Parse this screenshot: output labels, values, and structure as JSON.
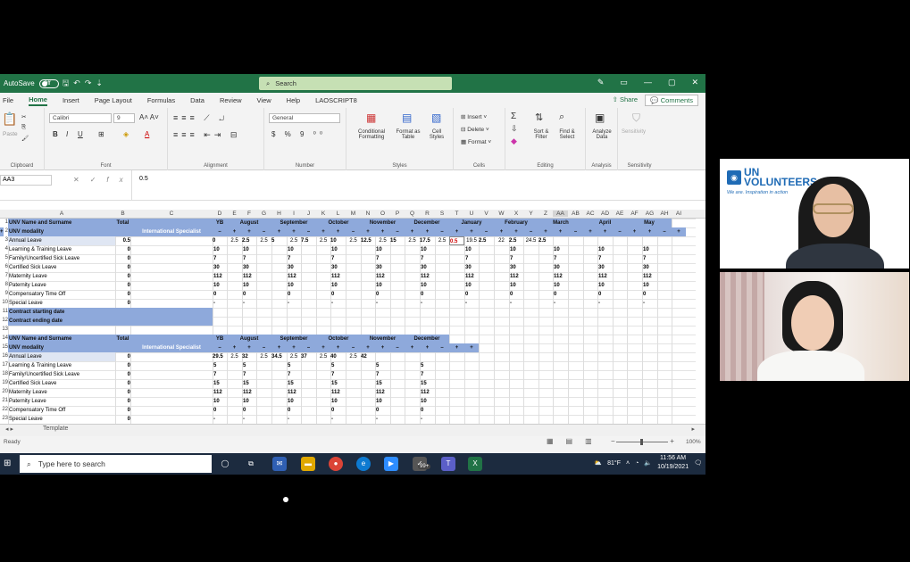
{
  "titlebar": {
    "autosave": "AutoSave",
    "autosave_state": "Off",
    "search": "Search"
  },
  "menu": [
    "File",
    "Home",
    "Insert",
    "Page Layout",
    "Formulas",
    "Data",
    "Review",
    "View",
    "Help",
    "LAOSCRIPT8"
  ],
  "menu_active": "Home",
  "share": "Share",
  "comments": "Comments",
  "ribbon": {
    "font_name": "Calibri",
    "font_size": "9",
    "number_format": "General",
    "paste": "Paste",
    "groups": [
      "Clipboard",
      "Font",
      "Alignment",
      "Number",
      "Styles",
      "Cells",
      "Editing",
      "Analysis",
      "Sensitivity"
    ],
    "conditional": "Conditional Formatting",
    "format_table": "Format as Table",
    "cell_styles": "Cell Styles",
    "insert": "Insert",
    "delete": "Delete",
    "format": "Format",
    "sort": "Sort & Filter",
    "find": "Find & Select",
    "analyze": "Analyze Data",
    "sensitivity": "Sensitivity"
  },
  "formula_bar": {
    "name_box": "AA3",
    "value": "0.5"
  },
  "columns": [
    "A",
    "B",
    "C",
    "D",
    "E",
    "F",
    "G",
    "H",
    "I",
    "J",
    "K",
    "L",
    "M",
    "N",
    "O",
    "P",
    "Q",
    "R",
    "S",
    "T",
    "U",
    "V",
    "W",
    "X",
    "Y",
    "Z",
    "AA",
    "AB",
    "AC",
    "AD",
    "AE",
    "AF",
    "AG",
    "AH",
    "AI"
  ],
  "row_numbers": [
    "1",
    "2",
    "3",
    "4",
    "5",
    "6",
    "7",
    "8",
    "9",
    "10",
    "11",
    "12",
    "13",
    "14",
    "15",
    "16",
    "17",
    "18",
    "19",
    "20",
    "21",
    "22",
    "23"
  ],
  "table1": {
    "name_hdr": "UNV Name and Surname",
    "modality": "UNV modality",
    "total": "Total",
    "specialist": "International Specialist",
    "months": [
      "YB",
      "August",
      "September",
      "October",
      "November",
      "December",
      "January",
      "February",
      "March",
      "April",
      "May"
    ],
    "rows": [
      {
        "label": "Annual Leave",
        "total": "0.5",
        "vals": [
          "0",
          "2.5",
          "2.5",
          "2.5",
          "5",
          "2.5",
          "7.5",
          "2.5",
          "10",
          "2.5",
          "12.5",
          "2.5",
          "15",
          "2.5",
          "17.5",
          "2.5",
          "0.5",
          "19.5",
          "2.5",
          "22",
          "2.5",
          "24.5",
          "2.5"
        ]
      },
      {
        "label": "Learning & Training Leave",
        "total": "0",
        "v": "10"
      },
      {
        "label": "Family/Uncertified Sick Leave",
        "total": "0",
        "v": "7"
      },
      {
        "label": "Certified Sick Leave",
        "total": "0",
        "v": "30"
      },
      {
        "label": "Maternity Leave",
        "total": "0",
        "v": "112"
      },
      {
        "label": "Paternity Leave",
        "total": "0",
        "v": "10"
      },
      {
        "label": "Compensatory Time Off",
        "total": "0",
        "v": "0"
      },
      {
        "label": "Special Leave",
        "total": "0",
        "v": "-"
      }
    ],
    "contract_start": "Contract starting date",
    "contract_end": "Contract ending date"
  },
  "table2": {
    "name_hdr": "UNV Name and Surname",
    "modality": "UNV modality",
    "total": "Total",
    "specialist": "International Specialist",
    "months": [
      "YB",
      "August",
      "September",
      "October",
      "November",
      "December"
    ],
    "rows": [
      {
        "label": "Annual Leave",
        "total": "0",
        "vals": [
          "29.5",
          "2.5",
          "32",
          "2.5",
          "34.5",
          "2.5",
          "37",
          "2.5",
          "40",
          "2.5",
          "42"
        ]
      },
      {
        "label": "Learning & Training Leave",
        "total": "0",
        "v": "5"
      },
      {
        "label": "Family/Uncertified Sick Leave",
        "total": "0",
        "v": "7"
      },
      {
        "label": "Certified Sick Leave",
        "total": "0",
        "v": "15"
      },
      {
        "label": "Maternity Leave",
        "total": "0",
        "v": "112"
      },
      {
        "label": "Paternity Leave",
        "total": "0",
        "v": "10"
      },
      {
        "label": "Compensatory Time Off",
        "total": "0",
        "v": "0"
      },
      {
        "label": "Special Leave",
        "total": "0",
        "v": "-"
      }
    ]
  },
  "sheet_tab": "Template",
  "status": {
    "ready": "Ready",
    "zoom": "100%"
  },
  "taskbar": {
    "search": "Type here to search",
    "temp": "81°F",
    "time": "11:56 AM",
    "date": "10/19/2021",
    "badge": "99+"
  },
  "video1": {
    "org": "UN",
    "org2": "VOLUNTEERS",
    "tagline": "We are. Inspiration in action"
  },
  "colors": {
    "excel_green": "#217346",
    "header_blue": "#8ea9db",
    "unv_blue": "#1f6bb5"
  }
}
